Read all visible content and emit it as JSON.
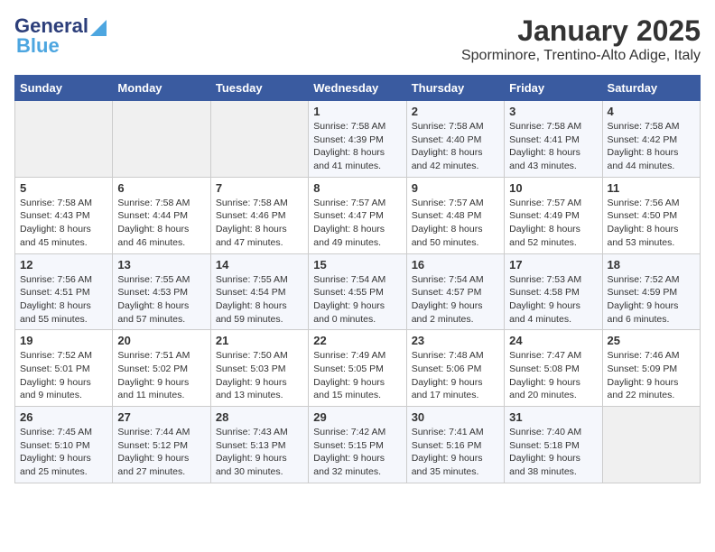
{
  "header": {
    "logo_general": "General",
    "logo_blue": "Blue",
    "month": "January 2025",
    "location": "Sporminore, Trentino-Alto Adige, Italy"
  },
  "weekdays": [
    "Sunday",
    "Monday",
    "Tuesday",
    "Wednesday",
    "Thursday",
    "Friday",
    "Saturday"
  ],
  "weeks": [
    [
      {
        "day": "",
        "info": ""
      },
      {
        "day": "",
        "info": ""
      },
      {
        "day": "",
        "info": ""
      },
      {
        "day": "1",
        "info": "Sunrise: 7:58 AM\nSunset: 4:39 PM\nDaylight: 8 hours and 41 minutes."
      },
      {
        "day": "2",
        "info": "Sunrise: 7:58 AM\nSunset: 4:40 PM\nDaylight: 8 hours and 42 minutes."
      },
      {
        "day": "3",
        "info": "Sunrise: 7:58 AM\nSunset: 4:41 PM\nDaylight: 8 hours and 43 minutes."
      },
      {
        "day": "4",
        "info": "Sunrise: 7:58 AM\nSunset: 4:42 PM\nDaylight: 8 hours and 44 minutes."
      }
    ],
    [
      {
        "day": "5",
        "info": "Sunrise: 7:58 AM\nSunset: 4:43 PM\nDaylight: 8 hours and 45 minutes."
      },
      {
        "day": "6",
        "info": "Sunrise: 7:58 AM\nSunset: 4:44 PM\nDaylight: 8 hours and 46 minutes."
      },
      {
        "day": "7",
        "info": "Sunrise: 7:58 AM\nSunset: 4:46 PM\nDaylight: 8 hours and 47 minutes."
      },
      {
        "day": "8",
        "info": "Sunrise: 7:57 AM\nSunset: 4:47 PM\nDaylight: 8 hours and 49 minutes."
      },
      {
        "day": "9",
        "info": "Sunrise: 7:57 AM\nSunset: 4:48 PM\nDaylight: 8 hours and 50 minutes."
      },
      {
        "day": "10",
        "info": "Sunrise: 7:57 AM\nSunset: 4:49 PM\nDaylight: 8 hours and 52 minutes."
      },
      {
        "day": "11",
        "info": "Sunrise: 7:56 AM\nSunset: 4:50 PM\nDaylight: 8 hours and 53 minutes."
      }
    ],
    [
      {
        "day": "12",
        "info": "Sunrise: 7:56 AM\nSunset: 4:51 PM\nDaylight: 8 hours and 55 minutes."
      },
      {
        "day": "13",
        "info": "Sunrise: 7:55 AM\nSunset: 4:53 PM\nDaylight: 8 hours and 57 minutes."
      },
      {
        "day": "14",
        "info": "Sunrise: 7:55 AM\nSunset: 4:54 PM\nDaylight: 8 hours and 59 minutes."
      },
      {
        "day": "15",
        "info": "Sunrise: 7:54 AM\nSunset: 4:55 PM\nDaylight: 9 hours and 0 minutes."
      },
      {
        "day": "16",
        "info": "Sunrise: 7:54 AM\nSunset: 4:57 PM\nDaylight: 9 hours and 2 minutes."
      },
      {
        "day": "17",
        "info": "Sunrise: 7:53 AM\nSunset: 4:58 PM\nDaylight: 9 hours and 4 minutes."
      },
      {
        "day": "18",
        "info": "Sunrise: 7:52 AM\nSunset: 4:59 PM\nDaylight: 9 hours and 6 minutes."
      }
    ],
    [
      {
        "day": "19",
        "info": "Sunrise: 7:52 AM\nSunset: 5:01 PM\nDaylight: 9 hours and 9 minutes."
      },
      {
        "day": "20",
        "info": "Sunrise: 7:51 AM\nSunset: 5:02 PM\nDaylight: 9 hours and 11 minutes."
      },
      {
        "day": "21",
        "info": "Sunrise: 7:50 AM\nSunset: 5:03 PM\nDaylight: 9 hours and 13 minutes."
      },
      {
        "day": "22",
        "info": "Sunrise: 7:49 AM\nSunset: 5:05 PM\nDaylight: 9 hours and 15 minutes."
      },
      {
        "day": "23",
        "info": "Sunrise: 7:48 AM\nSunset: 5:06 PM\nDaylight: 9 hours and 17 minutes."
      },
      {
        "day": "24",
        "info": "Sunrise: 7:47 AM\nSunset: 5:08 PM\nDaylight: 9 hours and 20 minutes."
      },
      {
        "day": "25",
        "info": "Sunrise: 7:46 AM\nSunset: 5:09 PM\nDaylight: 9 hours and 22 minutes."
      }
    ],
    [
      {
        "day": "26",
        "info": "Sunrise: 7:45 AM\nSunset: 5:10 PM\nDaylight: 9 hours and 25 minutes."
      },
      {
        "day": "27",
        "info": "Sunrise: 7:44 AM\nSunset: 5:12 PM\nDaylight: 9 hours and 27 minutes."
      },
      {
        "day": "28",
        "info": "Sunrise: 7:43 AM\nSunset: 5:13 PM\nDaylight: 9 hours and 30 minutes."
      },
      {
        "day": "29",
        "info": "Sunrise: 7:42 AM\nSunset: 5:15 PM\nDaylight: 9 hours and 32 minutes."
      },
      {
        "day": "30",
        "info": "Sunrise: 7:41 AM\nSunset: 5:16 PM\nDaylight: 9 hours and 35 minutes."
      },
      {
        "day": "31",
        "info": "Sunrise: 7:40 AM\nSunset: 5:18 PM\nDaylight: 9 hours and 38 minutes."
      },
      {
        "day": "",
        "info": ""
      }
    ]
  ]
}
